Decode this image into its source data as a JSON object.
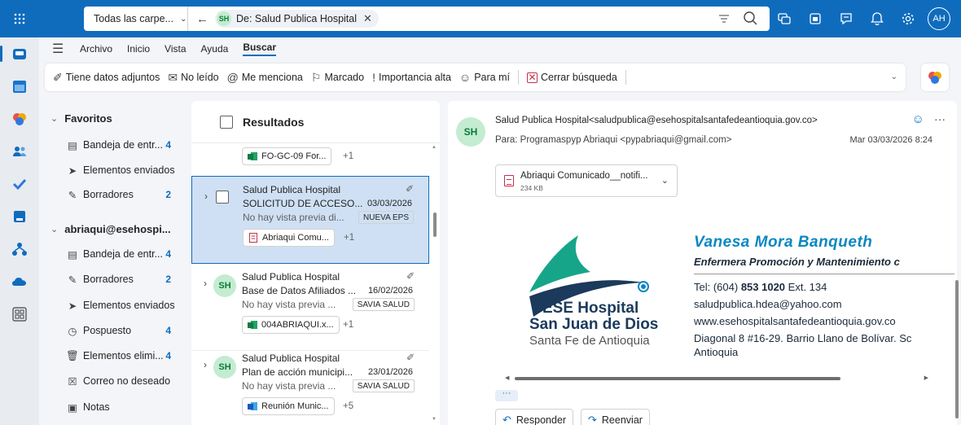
{
  "colors": {
    "brand": "#0f6cbd",
    "avatar_bg": "#c3ecd0",
    "avatar_fg": "#0e7a3c",
    "selected_row": "#cfe0f4",
    "link_name": "#0a87c2"
  },
  "topbar": {
    "scope_label": "Todas las carpe...",
    "chip_initials": "SH",
    "chip_label": "De: Salud Publica Hospital",
    "user_initials": "AH",
    "icons": [
      "apps-grid-icon",
      "filter-icon",
      "search-icon",
      "meet-now-icon",
      "teams-icon",
      "feedback-icon",
      "bell-icon",
      "settings-gear-icon"
    ]
  },
  "menu": {
    "items": [
      "Archivo",
      "Inicio",
      "Vista",
      "Ayuda",
      "Buscar"
    ],
    "active": "Buscar"
  },
  "ribbon": {
    "attachments": "Tiene datos adjuntos",
    "unread": "No leído",
    "mentions": "Me menciona",
    "flagged": "Marcado",
    "important": "Importancia alta",
    "to_me": "Para mí",
    "close": "Cerrar búsqueda"
  },
  "folders": {
    "favorites_header": "Favoritos",
    "favorites": [
      {
        "label": "Bandeja de entr...",
        "count": "4"
      },
      {
        "label": "Elementos enviados",
        "count": ""
      },
      {
        "label": "Borradores",
        "count": "2"
      }
    ],
    "account_header": "abriaqui@esehospi...",
    "account": [
      {
        "label": "Bandeja de entr...",
        "count": "4"
      },
      {
        "label": "Borradores",
        "count": "2"
      },
      {
        "label": "Elementos enviados",
        "count": ""
      },
      {
        "label": "Pospuesto",
        "count": "4"
      },
      {
        "label": "Elementos elimi...",
        "count": "4"
      },
      {
        "label": "Correo no deseado",
        "count": ""
      },
      {
        "label": "Notas",
        "count": ""
      }
    ]
  },
  "list": {
    "title": "Resultados",
    "top_attachment": {
      "name": "FO-GC-09 For...",
      "more": "+1"
    },
    "messages": [
      {
        "from": "Salud Publica Hospital",
        "subject": "SOLICITUD DE ACCESO...",
        "date": "03/03/2026",
        "preview": "No hay vista previa di...",
        "tag": "NUEVA EPS",
        "attachment": "Abriaqui Comu...",
        "more": "+1",
        "selected": true
      },
      {
        "initials": "SH",
        "from": "Salud Publica Hospital",
        "subject": "Base de Datos Afiliados ...",
        "date": "16/02/2026",
        "preview": "No hay vista previa ...",
        "tag": "SAVIA SALUD",
        "attachment": "004ABRIAQUI.x...",
        "more": "+1"
      },
      {
        "initials": "SH",
        "from": "Salud Publica Hospital",
        "subject": "Plan de acción municipi...",
        "date": "23/01/2026",
        "preview": "No hay vista previa ...",
        "tag": "SAVIA SALUD",
        "attachment": "Reunión Munic...",
        "more": "+5"
      }
    ]
  },
  "reader": {
    "initials": "SH",
    "from": "Salud Publica Hospital<saludpublica@esehospitalsantafedeantioquia.gov.co>",
    "to": "Para: Programaspyp Abriaqui <pypabriaqui@gmail.com>",
    "date": "Mar 03/03/2026 8:24",
    "attachment_name": "Abriaqui Comunicado__notifi...",
    "attachment_size": "234 KB",
    "signature": {
      "org_line1": "ESE Hospital",
      "org_line2": "San Juan de Dios",
      "org_line3": "Santa Fe de Antioquia",
      "name": "Vanesa Mora Banqueth",
      "role": "Enfermera Promoción y Mantenimiento c",
      "tel_prefix": "Tel: (604) ",
      "tel_number": "853 1020",
      "tel_ext": " Ext. 134",
      "email": "saludpublica.hdea@yahoo.com",
      "web": "www.esehospitalsantafedeantioquia.gov.co",
      "address1": "Diagonal 8 #16-29. Barrio Llano de Bolívar. Sc",
      "address2": "Antioquia"
    },
    "ellipsis": "···",
    "reply": "Responder",
    "forward": "Reenviar"
  }
}
